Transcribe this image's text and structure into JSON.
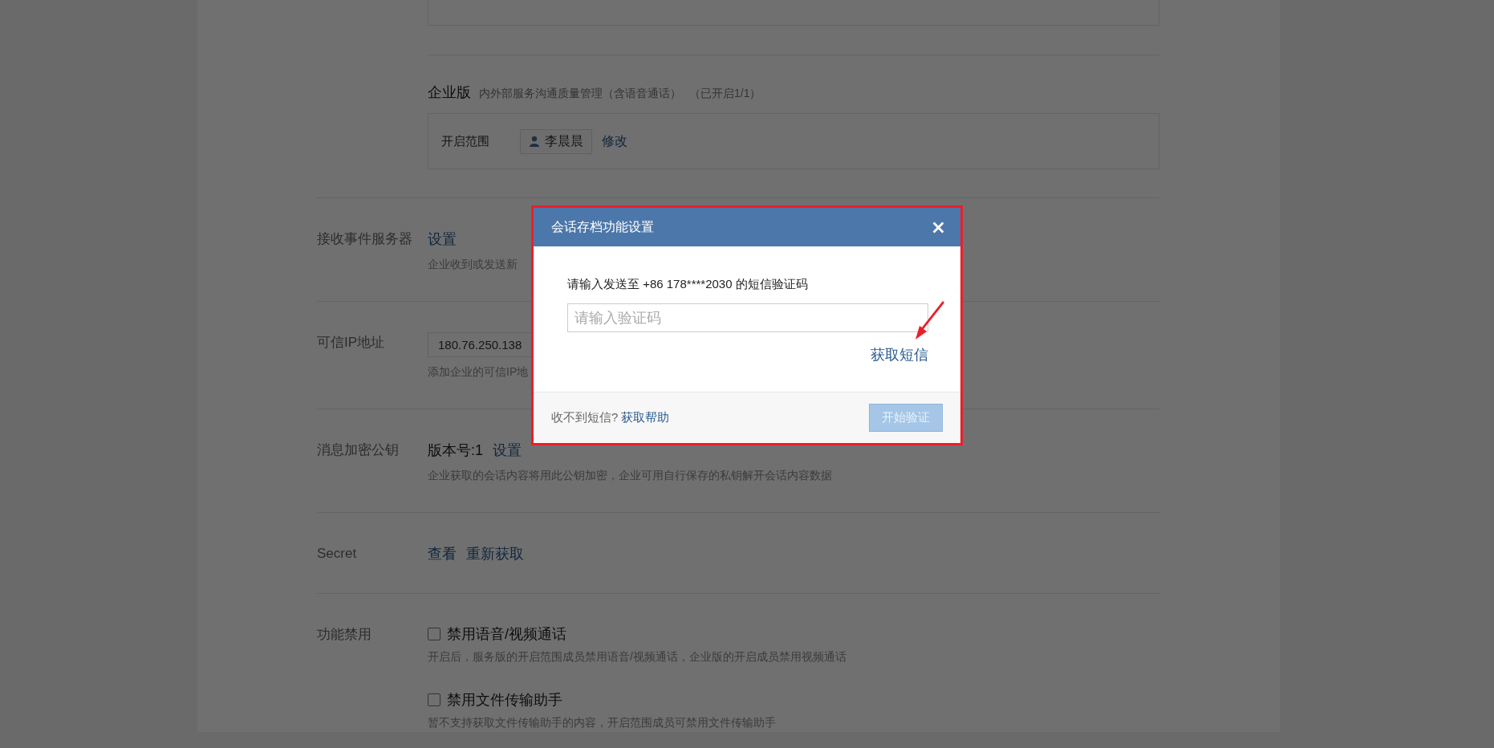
{
  "enterprise_edition": {
    "title": "企业版",
    "description": "内外部服务沟通质量管理（含语音通话）",
    "status": "（已开启1/1）",
    "scope_label": "开启范围",
    "member": "李晨晨",
    "edit_link": "修改"
  },
  "settings": [
    {
      "kind": "links",
      "label": "接收事件服务器",
      "links": [
        "设置"
      ],
      "description": "企业收到或发送新"
    },
    {
      "kind": "ip",
      "label": "可信IP地址",
      "value": "180.76.250.138",
      "description": "添加企业的可信IP地"
    },
    {
      "kind": "version",
      "label": "消息加密公钥",
      "version": "版本号:1",
      "links": [
        "设置"
      ],
      "description": "企业获取的会话内容将用此公钥加密，企业可用自行保存的私钥解开会话内容数据"
    },
    {
      "kind": "links",
      "label": "Secret",
      "links": [
        "查看",
        "重新获取"
      ]
    },
    {
      "kind": "checks",
      "label": "功能禁用",
      "options": [
        {
          "label": "禁用语音/视频通话",
          "checked": false,
          "description": "开启后，服务版的开启范围成员禁用语音/视频通话，企业版的开启成员禁用视频通话"
        },
        {
          "label": "禁用文件传输助手",
          "checked": false,
          "description": "暂不支持获取文件传输助手的内容，开启范围成员可禁用文件传输助手"
        }
      ]
    }
  ],
  "dialog": {
    "title": "会话存档功能设置",
    "prompt": "请输入发送至 +86 178****2030 的短信验证码",
    "placeholder": "请输入验证码",
    "sms_link": "获取短信",
    "help_text": "收不到短信?",
    "help_link": "获取帮助",
    "confirm": {
      "label": "开始验证",
      "disabled": true
    }
  }
}
